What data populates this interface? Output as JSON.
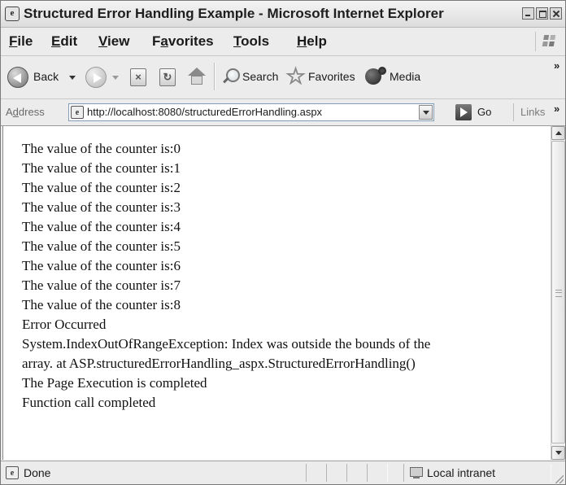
{
  "window": {
    "title": "Structured Error Handling Example - Microsoft Internet Explorer"
  },
  "menu": {
    "items": [
      {
        "u": "F",
        "rest": "ile"
      },
      {
        "u": "E",
        "rest": "dit"
      },
      {
        "u": "V",
        "rest": "iew"
      },
      {
        "pre": "F",
        "u": "a",
        "rest": "vorites"
      },
      {
        "u": "T",
        "rest": "ools"
      },
      {
        "u": "H",
        "rest": "elp"
      }
    ]
  },
  "toolbar": {
    "back_label": "Back",
    "search_label": "Search",
    "favorites_label": "Favorites",
    "media_label": "Media",
    "more_chevron": "»"
  },
  "address": {
    "label_u": "d",
    "label_pre": "A",
    "label_rest": "dress",
    "url": "http://localhost:8080/structuredErrorHandling.aspx",
    "go_label": "Go",
    "links_label": "Links",
    "links_chevron": "»"
  },
  "content": {
    "lines": [
      "The value of the counter is:0",
      "The value of the counter is:1",
      "The value of the counter is:2",
      "The value of the counter is:3",
      "The value of the counter is:4",
      "The value of the counter is:5",
      "The value of the counter is:6",
      "The value of the counter is:7",
      "The value of the counter is:8",
      "Error Occurred",
      "System.IndexOutOfRangeException: Index was outside the bounds of the",
      "array. at ASP.structuredErrorHandling_aspx.StructuredErrorHandling()",
      "The Page Execution is completed",
      "Function call completed"
    ]
  },
  "status": {
    "text": "Done",
    "zone": "Local intranet"
  }
}
